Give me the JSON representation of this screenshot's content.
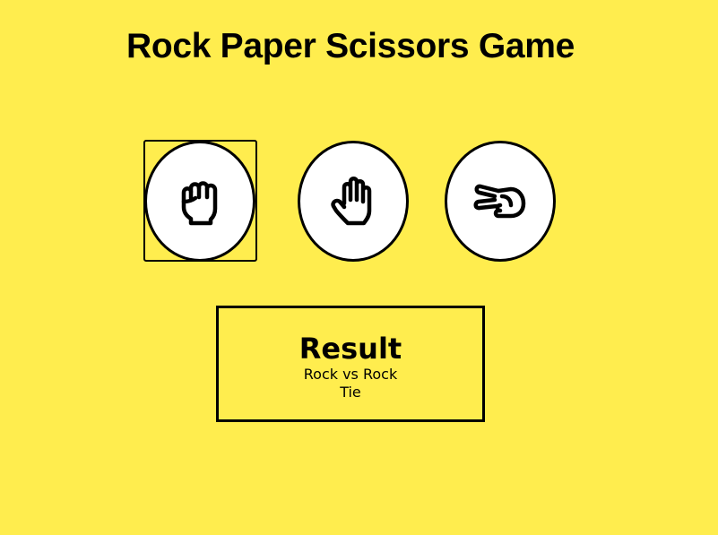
{
  "title": "Rock Paper Scissors Game",
  "choices": [
    {
      "name": "Rock",
      "icon": "fist-icon"
    },
    {
      "name": "Paper",
      "icon": "open-hand-icon"
    },
    {
      "name": "Scissors",
      "icon": "scissors-hand-icon"
    }
  ],
  "selected_choice": "Rock",
  "result": {
    "heading": "Result",
    "matchup": "Rock vs Rock",
    "outcome": "Tie"
  },
  "colors": {
    "background": "#ffed4e",
    "button_fill": "#ffffff",
    "border": "#000000"
  }
}
